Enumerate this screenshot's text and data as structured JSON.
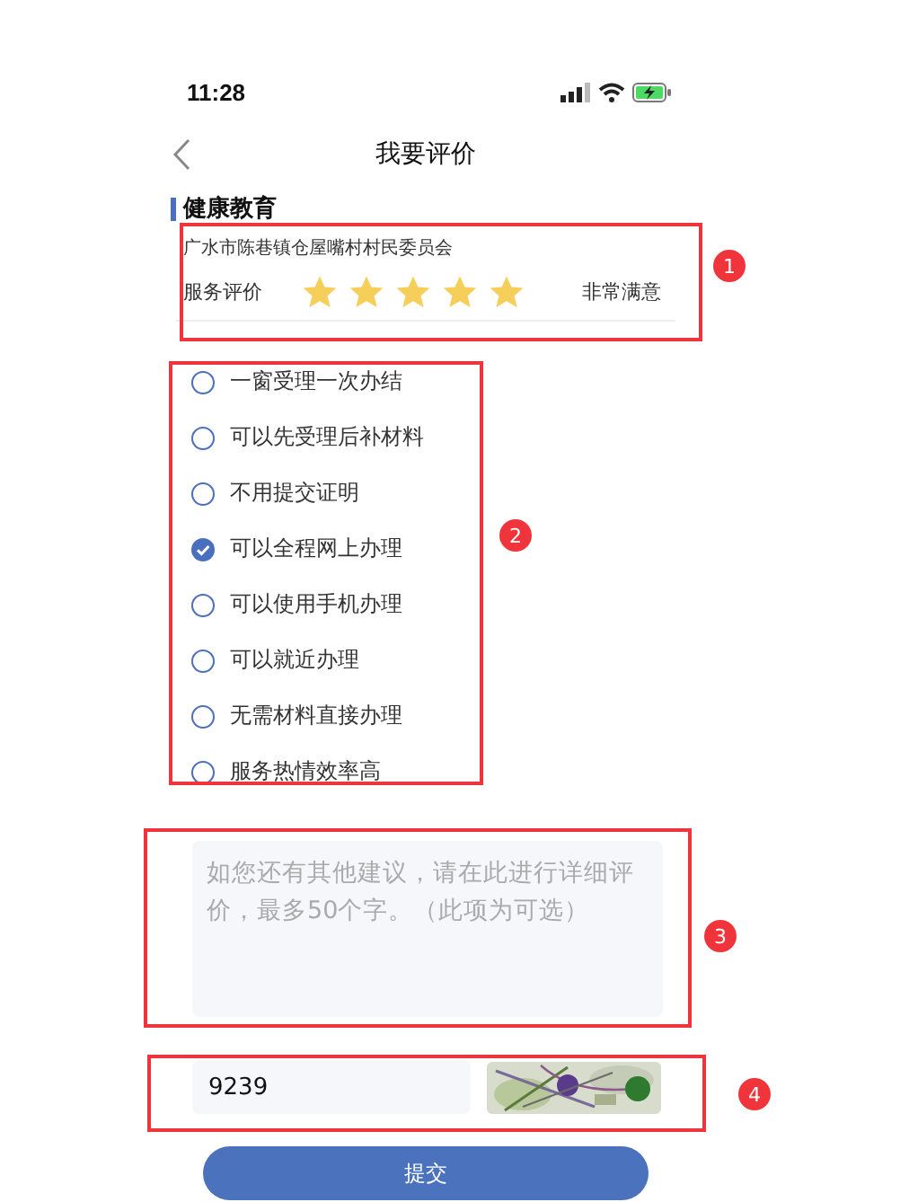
{
  "status_bar": {
    "time": "11:28"
  },
  "nav": {
    "title": "我要评价"
  },
  "section": {
    "title": "健康教育"
  },
  "rating_card": {
    "organization": "广水市陈巷镇仓屋嘴村村民委员会",
    "label": "服务评价",
    "stars": 5,
    "verdict": "非常满意"
  },
  "options": [
    {
      "label": "一窗受理一次办结",
      "selected": false
    },
    {
      "label": "可以先受理后补材料",
      "selected": false
    },
    {
      "label": "不用提交证明",
      "selected": false
    },
    {
      "label": "可以全程网上办理",
      "selected": true
    },
    {
      "label": "可以使用手机办理",
      "selected": false
    },
    {
      "label": "可以就近办理",
      "selected": false
    },
    {
      "label": "无需材料直接办理",
      "selected": false
    },
    {
      "label": "服务热情效率高",
      "selected": false
    }
  ],
  "comment": {
    "placeholder": "如您还有其他建议，请在此进行详细评价，最多50个字。（此项为可选）"
  },
  "captcha": {
    "value": "9239"
  },
  "submit_button": "提交",
  "annotations": [
    {
      "number": "1"
    },
    {
      "number": "2"
    },
    {
      "number": "3"
    },
    {
      "number": "4"
    }
  ]
}
